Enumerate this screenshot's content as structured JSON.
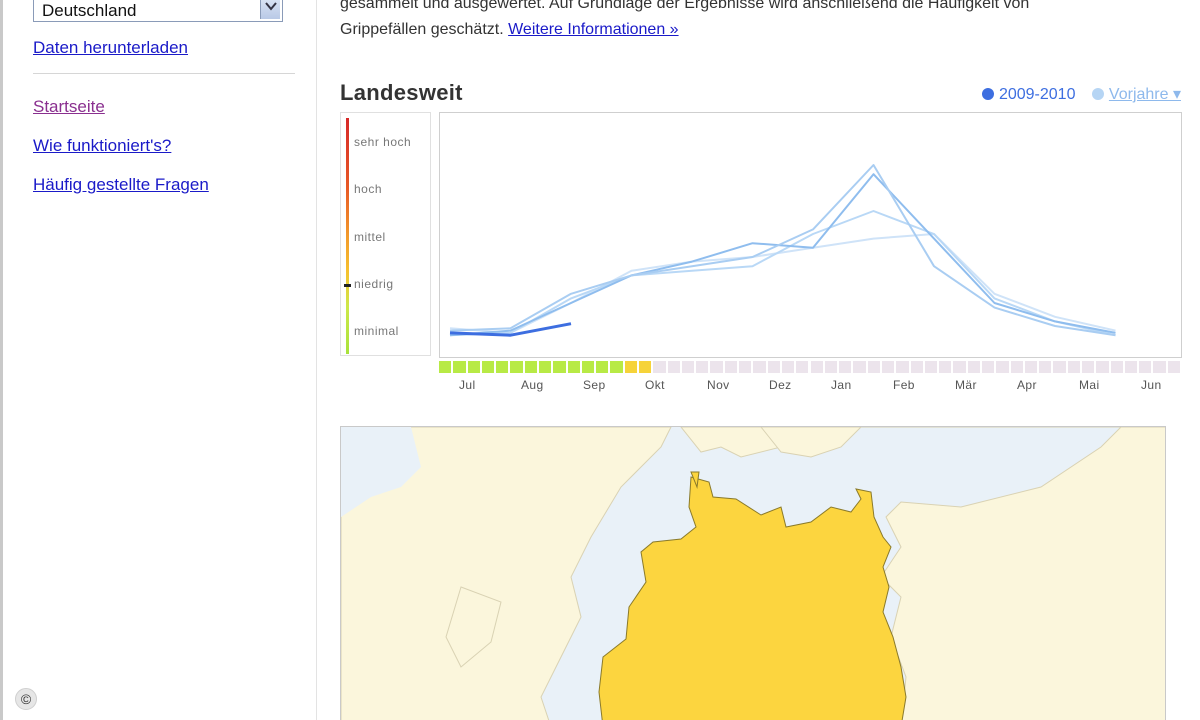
{
  "sidebar": {
    "region_select_value": "Deutschland",
    "links": {
      "download": "Daten herunterladen",
      "home": "Startseite",
      "how": "Wie funktioniert's?",
      "faq": "Häufig gestellte Fragen"
    },
    "copyright_symbol": "©"
  },
  "intro": {
    "line1": "gesammelt und ausgewertet. Auf Grundlage der Ergebnisse wird anschließend die Häufigkeit von",
    "line2": "Grippefällen geschätzt.",
    "more_link": "Weitere Informationen »"
  },
  "chart": {
    "title": "Landesweit",
    "legend": {
      "current": "2009-2010",
      "previous": "Vorjahre ▾"
    },
    "colors": {
      "current": "#3d6ee0",
      "previous": "#9cc6f0"
    },
    "levels": [
      "sehr hoch",
      "hoch",
      "mittel",
      "niedrig",
      "minimal"
    ]
  },
  "chart_data": {
    "type": "line",
    "title": "Landesweit",
    "x": [
      "Jul",
      "Aug",
      "Sep",
      "Okt",
      "Nov",
      "Dez",
      "Jan",
      "Feb",
      "Mär",
      "Apr",
      "Mai",
      "Jun"
    ],
    "y_levels": [
      "minimal",
      "niedrig",
      "mittel",
      "hoch",
      "sehr hoch"
    ],
    "series": [
      {
        "name": "2009-2010",
        "values": [
          0.35,
          0.3,
          0.55
        ]
      },
      {
        "values": [
          0.4,
          0.45,
          1.2,
          1.6,
          1.8,
          2.0,
          2.6,
          4.0,
          1.8,
          0.9,
          0.5,
          0.3
        ]
      },
      {
        "values": [
          0.3,
          0.4,
          1.0,
          1.6,
          1.9,
          2.3,
          2.2,
          3.8,
          2.4,
          1.0,
          0.6,
          0.35
        ]
      },
      {
        "values": [
          0.3,
          0.35,
          1.1,
          1.6,
          1.7,
          1.8,
          2.5,
          3.0,
          2.5,
          1.1,
          0.6,
          0.3
        ]
      },
      {
        "values": [
          0.45,
          0.35,
          1.0,
          1.7,
          1.9,
          2.0,
          2.2,
          2.4,
          2.5,
          1.2,
          0.7,
          0.4
        ]
      }
    ],
    "week_strip": {
      "weeks_shown": 52,
      "colored_weeks": [
        "green",
        "green",
        "green",
        "green",
        "green",
        "green",
        "green",
        "green",
        "green",
        "green",
        "green",
        "green",
        "green",
        "yellow",
        "yellow"
      ]
    }
  },
  "map": {
    "land_color": "#fbf6dc",
    "water_color": "#e9f1f8",
    "highlight_color": "#fcd53f"
  }
}
